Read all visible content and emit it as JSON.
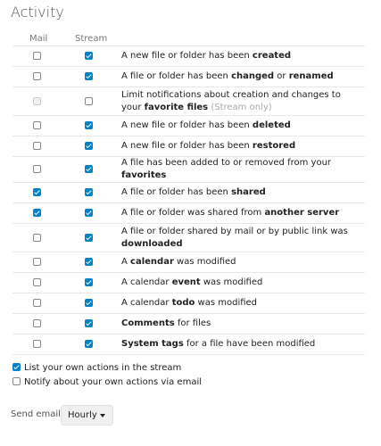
{
  "title": "Activity",
  "columns": {
    "mail": "Mail",
    "stream": "Stream"
  },
  "rows": [
    {
      "mail": false,
      "stream": true,
      "parts": [
        "A new file or folder has been ",
        "created",
        ""
      ]
    },
    {
      "mail": false,
      "stream": true,
      "parts": [
        "A file or folder has been ",
        "changed",
        " or ",
        "renamed"
      ]
    },
    {
      "mail": false,
      "mail_disabled": true,
      "stream": false,
      "parts": [
        "Limit notifications about creation and changes to your ",
        "favorite files",
        " ",
        "(Stream only)"
      ]
    },
    {
      "mail": false,
      "stream": true,
      "parts": [
        "A new file or folder has been ",
        "deleted",
        ""
      ]
    },
    {
      "mail": false,
      "stream": true,
      "parts": [
        "A new file or folder has been ",
        "restored",
        ""
      ]
    },
    {
      "mail": false,
      "stream": true,
      "parts": [
        "A file has been added to or removed from your ",
        "favorites",
        ""
      ]
    },
    {
      "mail": true,
      "stream": true,
      "parts": [
        "A file or folder has been ",
        "shared",
        ""
      ]
    },
    {
      "mail": true,
      "stream": true,
      "parts": [
        "A file or folder was shared from ",
        "another server",
        ""
      ]
    },
    {
      "mail": false,
      "stream": true,
      "parts": [
        "A file or folder shared by mail or by public link was ",
        "downloaded",
        ""
      ]
    },
    {
      "mail": false,
      "stream": true,
      "parts": [
        "A ",
        "calendar",
        " was modified"
      ]
    },
    {
      "mail": false,
      "stream": true,
      "parts": [
        "A calendar ",
        "event",
        " was modified"
      ]
    },
    {
      "mail": false,
      "stream": true,
      "parts": [
        "A calendar ",
        "todo",
        " was modified"
      ]
    },
    {
      "mail": false,
      "stream": true,
      "parts": [
        "",
        "Comments",
        " for files"
      ]
    },
    {
      "mail": false,
      "stream": true,
      "parts": [
        "",
        "System tags",
        " for a file have been modified"
      ]
    }
  ],
  "options": {
    "own_actions_stream": {
      "label": "List your own actions in the stream",
      "checked": true
    },
    "notify_own_email": {
      "label": "Notify about your own actions via email",
      "checked": false
    }
  },
  "send_emails": {
    "label": "Send emails:",
    "value": "Hourly"
  }
}
